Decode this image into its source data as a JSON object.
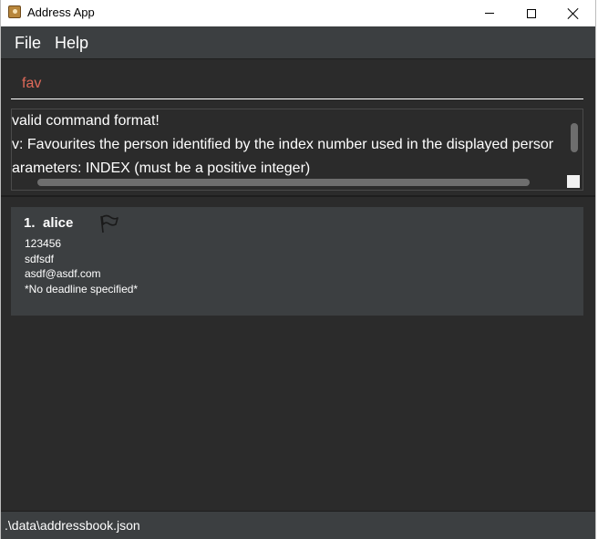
{
  "window": {
    "title": "Address App"
  },
  "menu": {
    "file": "File",
    "help": "Help"
  },
  "command": {
    "value": "fav"
  },
  "result": {
    "lines": [
      "valid command format!",
      "v: Favourites the person identified by the index number used in the displayed persor",
      "arameters: INDEX (must be a positive integer)"
    ]
  },
  "persons": [
    {
      "index": "1.",
      "name": "alice",
      "phone": "123456",
      "address": "sdfsdf",
      "email": "asdf@asdf.com",
      "deadline": "*No deadline specified*",
      "flag_icon": "flag-icon"
    }
  ],
  "status": {
    "file_path": ".\\data\\addressbook.json"
  },
  "colors": {
    "background": "#2b2b2b",
    "panel": "#3c3f41",
    "command_text": "#e06a5a",
    "text": "#ffffff"
  }
}
